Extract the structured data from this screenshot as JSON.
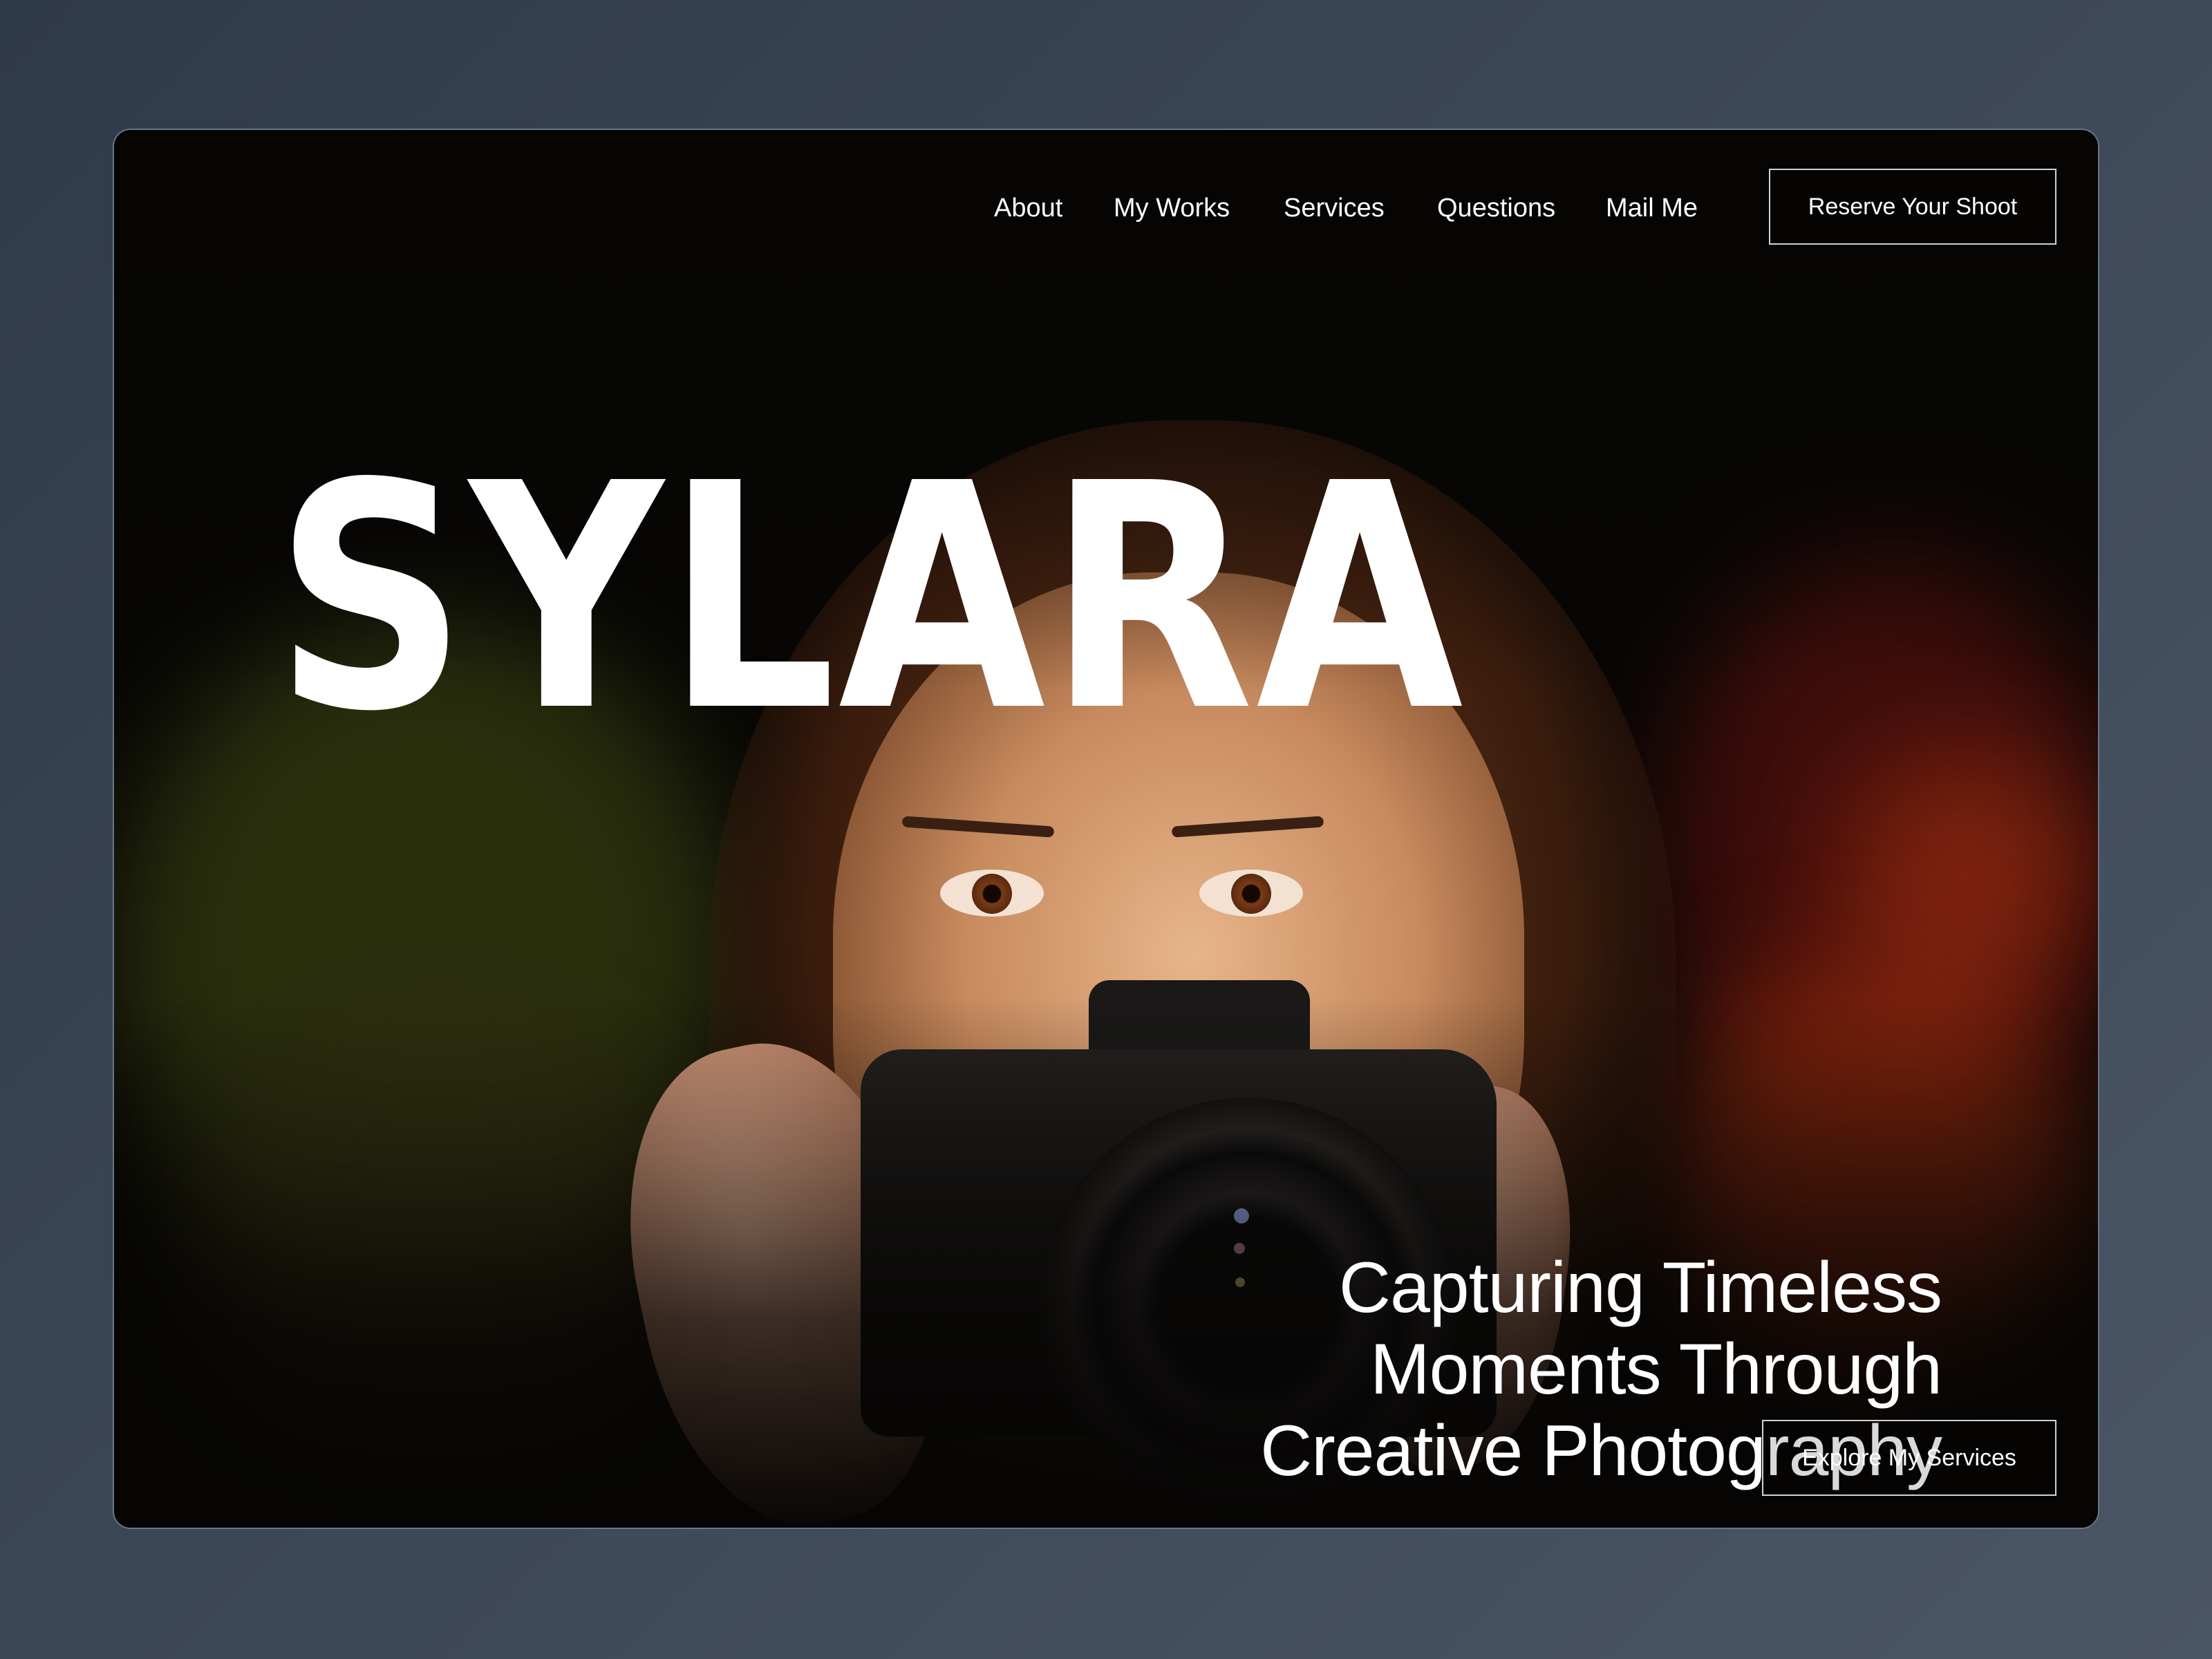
{
  "nav": {
    "links": [
      {
        "label": "About"
      },
      {
        "label": "My Works"
      },
      {
        "label": "Services"
      },
      {
        "label": "Questions"
      },
      {
        "label": "Mail Me"
      }
    ],
    "cta_label": "Reserve Your Shoot"
  },
  "hero": {
    "brand": "SYLARA",
    "tagline_lines": [
      "Capturing Timeless",
      "Moments Through",
      "Creative Photography"
    ],
    "cta_label": "Explore My Services"
  },
  "colors": {
    "page_background": "#3b4656",
    "hero_background": "#070605",
    "text": "#ffffff",
    "button_border": "#cfd2d6"
  }
}
